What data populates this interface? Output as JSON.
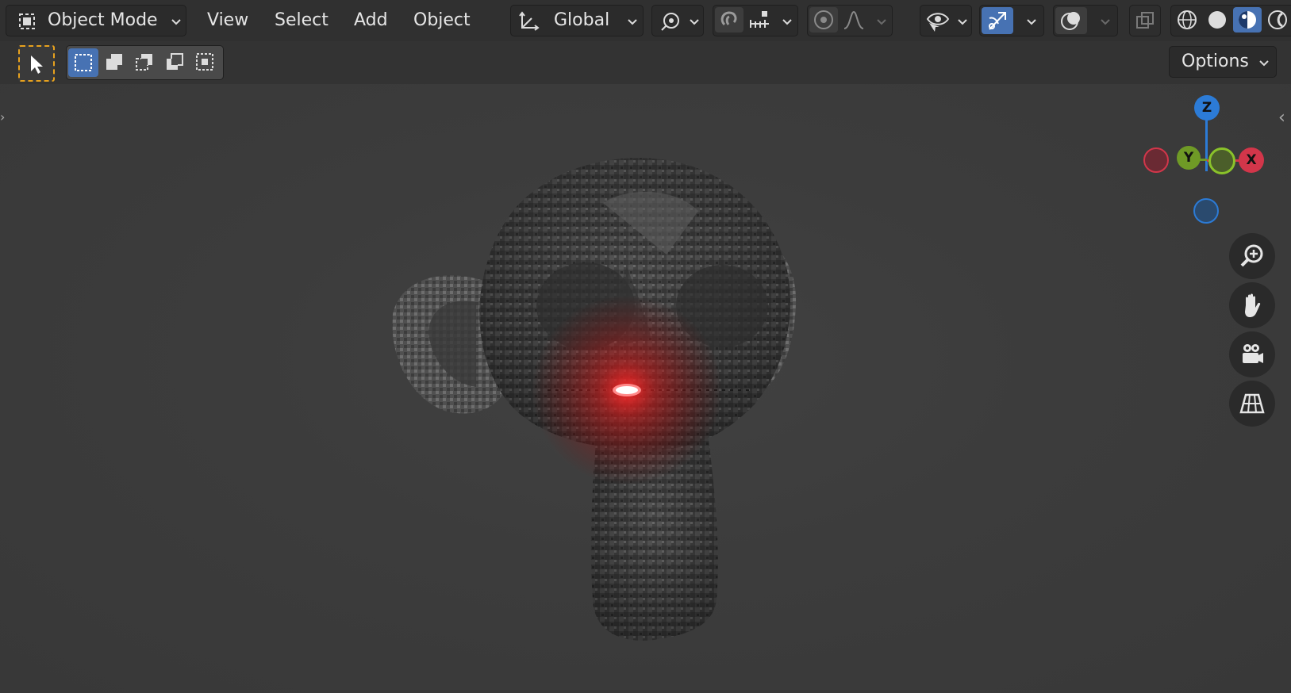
{
  "header": {
    "mode_label": "Object Mode",
    "menus": [
      "View",
      "Select",
      "Add",
      "Object"
    ],
    "orientation_label": "Global",
    "options_label": "Options"
  },
  "toolbar_icons": {
    "mode": "object-mode-icon",
    "orientation": "transform-orientation-icon",
    "pivot": "pivot-point-icon",
    "snap": "snap-magnet-icon",
    "snap_target": "snap-increment-icon",
    "proportional": "proportional-editing-icon",
    "falloff": "falloff-curve-icon",
    "visibility": "eye-visibility-icon",
    "gizmo": "gizmo-toggle-icon",
    "overlay": "overlay-icon",
    "xray": "xray-toggle-icon",
    "shading_wire": "wireframe-shading-icon",
    "shading_solid": "solid-shading-icon",
    "shading_material": "material-preview-icon",
    "shading_rendered": "rendered-shading-icon"
  },
  "navigation_gizmo": {
    "axes": [
      {
        "label": "Z",
        "color": "#2c7bd6"
      },
      {
        "label": "Y",
        "color": "#6f9a26"
      },
      {
        "label": "X",
        "color": "#d2364a"
      }
    ]
  },
  "nav_buttons": [
    "zoom-icon",
    "pan-hand-icon",
    "camera-view-icon",
    "perspective-grid-icon"
  ],
  "colors": {
    "accent": "#4772b3",
    "select_tool": "#e8a21e",
    "background": "#3a3a3a",
    "glow": "#ff2222"
  }
}
